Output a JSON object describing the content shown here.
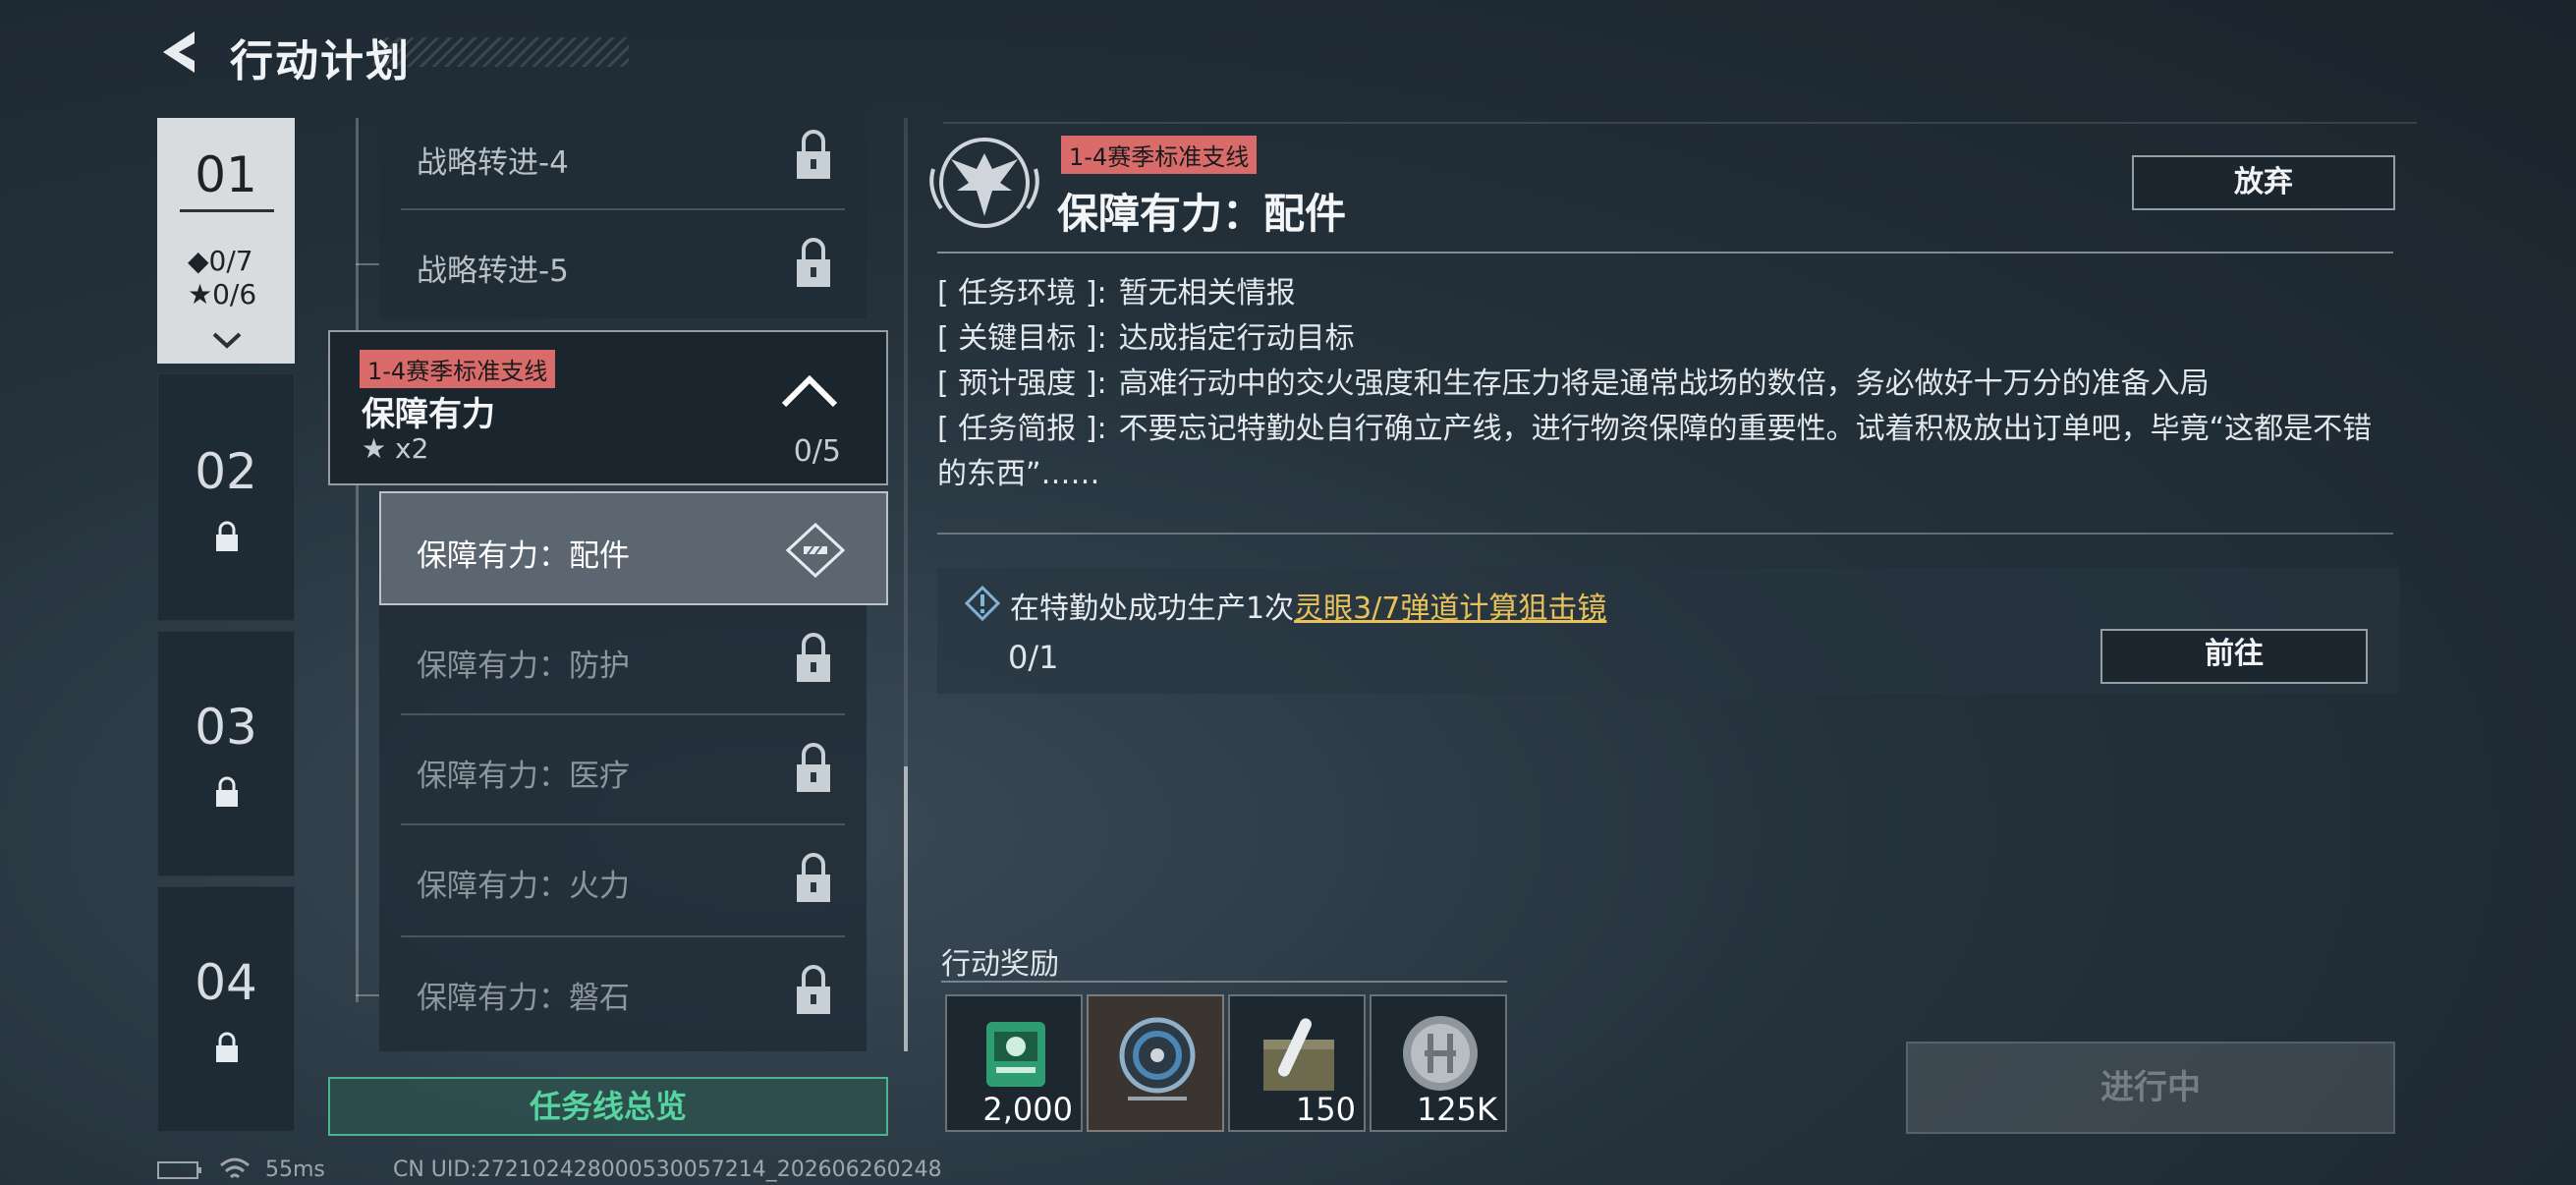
{
  "header": {
    "title": "行动计划"
  },
  "chapters": [
    {
      "num": "01",
      "diamond_stat": "◆0/7",
      "star_stat": "★0/6"
    },
    {
      "num": "02"
    },
    {
      "num": "03"
    },
    {
      "num": "04"
    }
  ],
  "quest_list": {
    "above_items": [
      "战略转进-4",
      "战略转进-5"
    ],
    "group": {
      "tag": "1-4赛季标准支线",
      "title": "保障有力",
      "stars": "★ x2",
      "progress": "0/5"
    },
    "active_item": "保障有力：配件",
    "locked_items": [
      "保障有力：防护",
      "保障有力：医疗",
      "保障有力：火力",
      "保障有力：磐石"
    ],
    "overview_button": "任务线总览"
  },
  "detail": {
    "tag": "1-4赛季标准支线",
    "title": "保障有力：配件",
    "abandon_button": "放弃",
    "info": [
      {
        "key": "[ 任务环境 ]:",
        "value": "暂无相关情报"
      },
      {
        "key": "[ 关键目标 ]:",
        "value": "达成指定行动目标"
      },
      {
        "key": "[ 预计强度 ]:",
        "value": "高难行动中的交火强度和生存压力将是通常战场的数倍，务必做好十万分的准备入局"
      },
      {
        "key": "[ 任务简报 ]:",
        "value": "不要忘记特勤处自行确立产线，进行物资保障的重要性。试着积极放出订单吧，毕竟“这都是不错的东西”……"
      }
    ],
    "objective": {
      "prefix": "在特勤处成功生产1次",
      "link": "灵眼3/7弹道计算狙击镜",
      "progress": "0/1",
      "goto_button": "前往"
    },
    "rewards_title": "行动奖励",
    "rewards": [
      {
        "name": "green-case-icon",
        "qty": "2,000"
      },
      {
        "name": "cable-reel-icon",
        "qty": ""
      },
      {
        "name": "ammo-box-icon",
        "qty": "150"
      },
      {
        "name": "coin-icon",
        "qty": "125K"
      }
    ],
    "status_button": "进行中"
  },
  "footer": {
    "ping": "55ms",
    "uid": "CN UID:272102428000530057214_202606260248"
  },
  "colors": {
    "tag_bg": "#d96b6b",
    "link": "#e8c15a",
    "overview_green": "#56d49f"
  }
}
